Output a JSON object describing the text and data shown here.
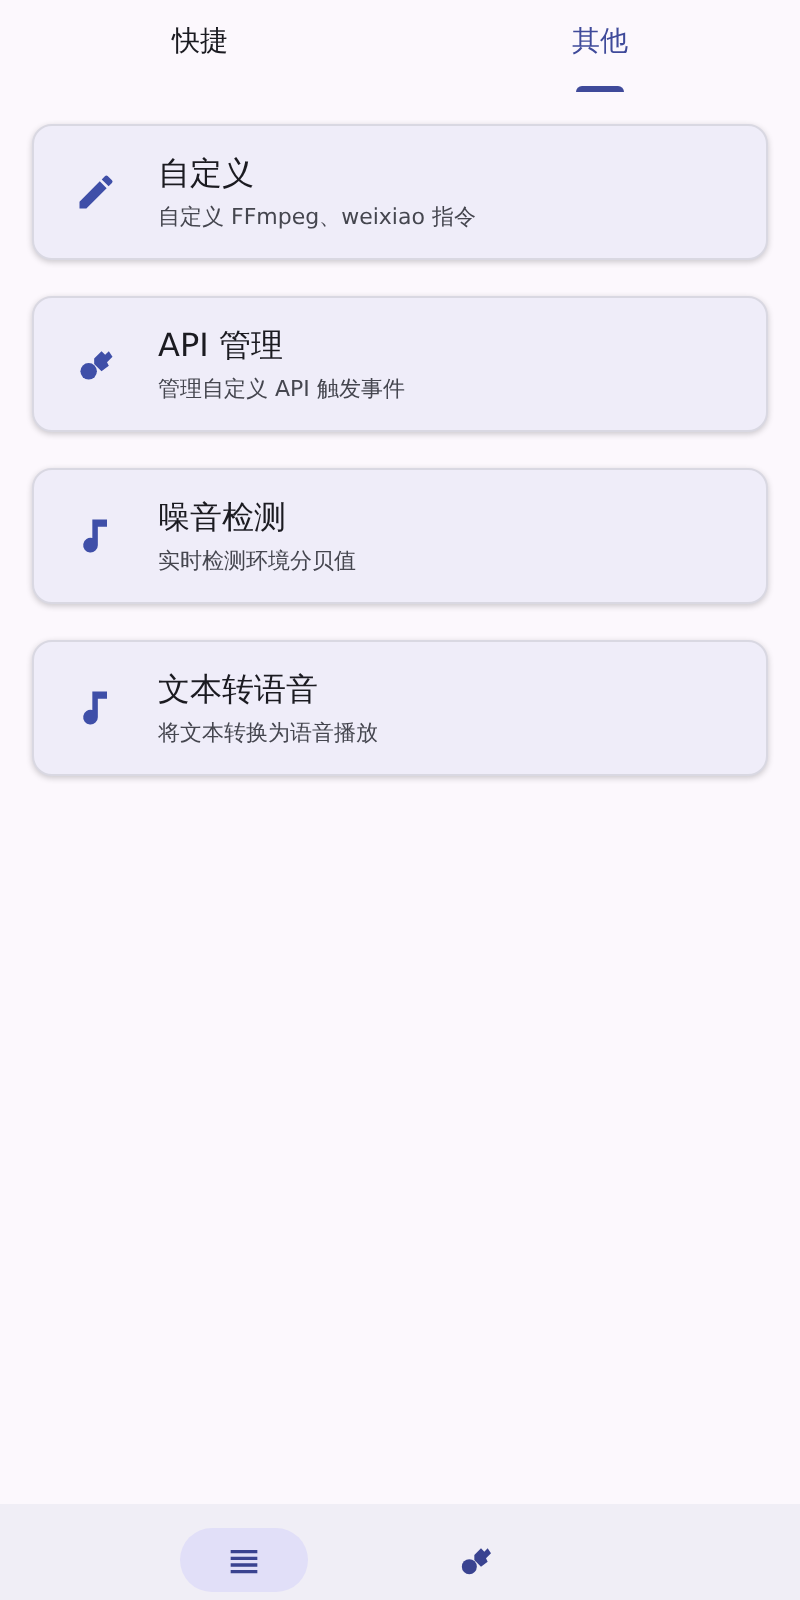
{
  "tabs": [
    {
      "label": "快捷",
      "selected": false
    },
    {
      "label": "其他",
      "selected": true
    }
  ],
  "items": [
    {
      "kind": "pencil",
      "title": "自定义",
      "subtitle": "自定义 FFmpeg、weixiao 指令"
    },
    {
      "kind": "tools",
      "title": "API 管理",
      "subtitle": "管理自定义 API 触发事件"
    },
    {
      "kind": "note",
      "title": "噪音检测",
      "subtitle": "实时检测环境分贝值"
    },
    {
      "kind": "note",
      "title": "文本转语音",
      "subtitle": "将文本转换为语音播放"
    }
  ],
  "bottom_nav": [
    {
      "kind": "menu",
      "selected": true
    },
    {
      "kind": "tools",
      "selected": false
    }
  ]
}
